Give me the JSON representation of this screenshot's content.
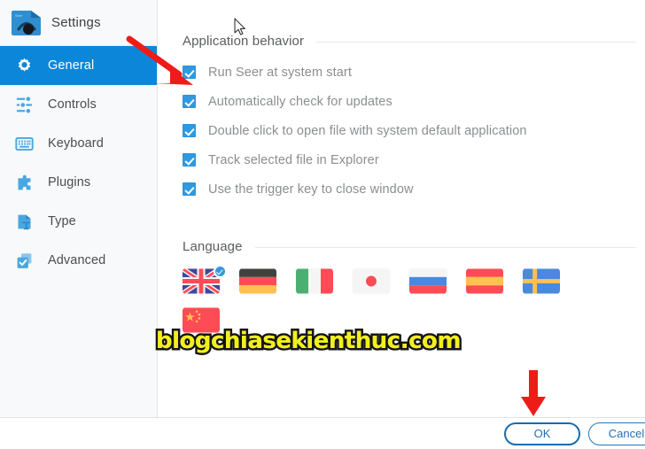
{
  "app": {
    "title": "Settings",
    "logo_icon": "seer-logo-icon"
  },
  "sidebar": {
    "items": [
      {
        "label": "General",
        "icon": "gear-icon",
        "selected": true
      },
      {
        "label": "Controls",
        "icon": "sliders-icon",
        "selected": false
      },
      {
        "label": "Keyboard",
        "icon": "keyboard-icon",
        "selected": false
      },
      {
        "label": "Plugins",
        "icon": "plugin-icon",
        "selected": false
      },
      {
        "label": "Type",
        "icon": "file-type-icon",
        "selected": false
      },
      {
        "label": "Advanced",
        "icon": "checkbox-stack-icon",
        "selected": false
      }
    ]
  },
  "main": {
    "sections": [
      {
        "title": "Application behavior"
      },
      {
        "title": "Language"
      }
    ],
    "checkboxes": [
      {
        "label": "Run Seer at system start",
        "checked": true
      },
      {
        "label": "Automatically check for updates",
        "checked": true
      },
      {
        "label": "Double click to open file with system default application",
        "checked": true
      },
      {
        "label": "Track selected file in Explorer",
        "checked": true
      },
      {
        "label": "Use the trigger key to close window",
        "checked": true
      }
    ],
    "languages": [
      {
        "name": "English",
        "flag": "flag-uk",
        "selected": true
      },
      {
        "name": "German",
        "flag": "flag-germany",
        "selected": false
      },
      {
        "name": "Italian",
        "flag": "flag-italy",
        "selected": false
      },
      {
        "name": "Japanese",
        "flag": "flag-japan",
        "selected": false
      },
      {
        "name": "Russian",
        "flag": "flag-russia",
        "selected": false
      },
      {
        "name": "Spanish",
        "flag": "flag-spain",
        "selected": false
      },
      {
        "name": "Swedish",
        "flag": "flag-sweden",
        "selected": false
      },
      {
        "name": "Chinese",
        "flag": "flag-china",
        "selected": false
      }
    ]
  },
  "footer": {
    "ok_label": "OK",
    "cancel_label": "Cancel"
  },
  "annotations": {
    "watermark_text": "blogchiasekienthuc.com",
    "arrow_color": "#ee1c18",
    "arrows": [
      {
        "name": "arrow-to-first-checkbox"
      },
      {
        "name": "arrow-to-ok-button"
      }
    ]
  },
  "colors": {
    "accent": "#0c86d8",
    "checkbox": "#2f9ae0",
    "button_border": "#2178b5",
    "sidebar_bg": "#f7f9fb"
  }
}
